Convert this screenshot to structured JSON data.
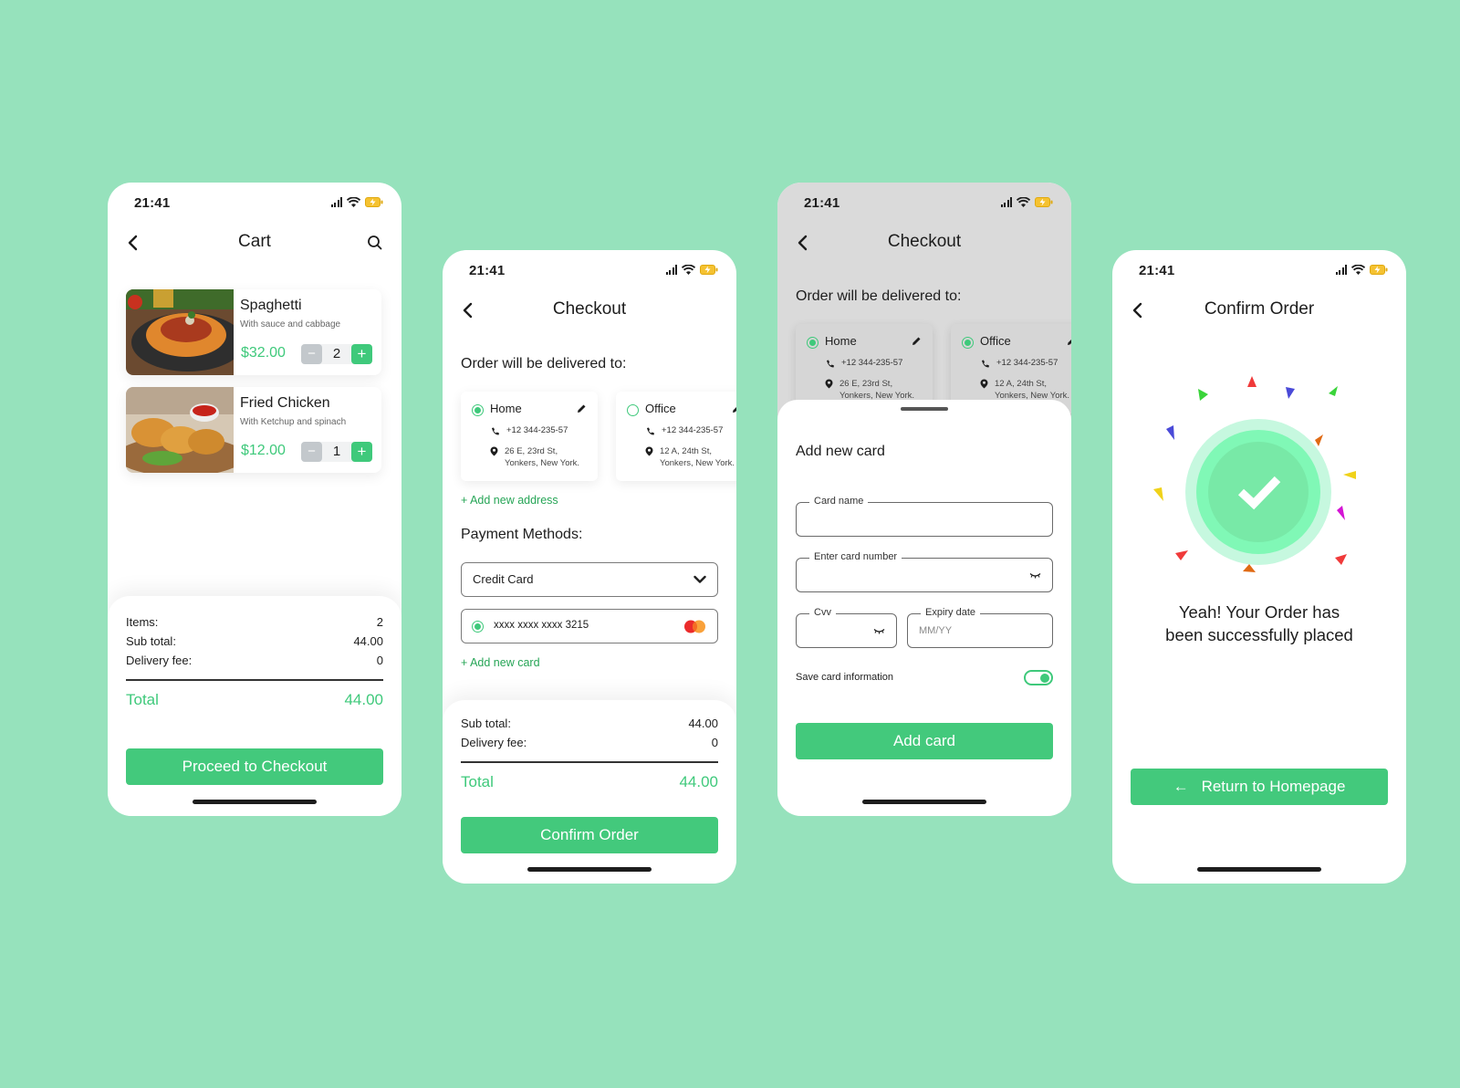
{
  "colors": {
    "background": "#96e2bc",
    "accent": "#43c97c",
    "accent_text": "#3fc97b",
    "link": "#26a556"
  },
  "status_bar": {
    "time": "21:41",
    "icons": [
      "signal-icon",
      "wifi-icon",
      "battery-charging-icon"
    ]
  },
  "cart": {
    "title": "Cart",
    "back_icon": "chevron-left-icon",
    "search_icon": "search-icon",
    "items": [
      {
        "name": "Spaghetti",
        "description": "With sauce and cabbage",
        "price": "$32.00",
        "quantity": "2",
        "image": "spaghetti-photo"
      },
      {
        "name": "Fried Chicken",
        "description": "With Ketchup and spinach",
        "price": "$12.00",
        "quantity": "1",
        "image": "fried-chicken-photo"
      }
    ],
    "stepper": {
      "minus": "−",
      "plus": "+"
    },
    "summary": {
      "items_label": "Items:",
      "items_value": "2",
      "subtotal_label": "Sub total:",
      "subtotal_value": "44.00",
      "delivery_label": "Delivery fee:",
      "delivery_value": "0",
      "total_label": "Total",
      "total_value": "44.00"
    },
    "proceed_button": "Proceed to Checkout"
  },
  "checkout": {
    "title": "Checkout",
    "delivered_to_label": "Order will be delivered to:",
    "addresses": [
      {
        "label": "Home",
        "phone": "+12 344-235-57",
        "address_line1": "26 E, 23rd St,",
        "address_line2": "Yonkers, New York.",
        "selected": true
      },
      {
        "label": "Office",
        "phone": "+12 344-235-57",
        "address_line1": "12 A, 24th St,",
        "address_line2": "Yonkers, New York.",
        "selected": false
      }
    ],
    "add_address_link": "+ Add new address",
    "payment_label": "Payment Methods:",
    "payment_method_selected": "Credit Card",
    "saved_card": "xxxx xxxx xxxx 3215",
    "card_brand": "mastercard-icon",
    "add_card_link": "+ Add new card",
    "summary": {
      "subtotal_label": "Sub total:",
      "subtotal_value": "44.00",
      "delivery_label": "Delivery fee:",
      "delivery_value": "0",
      "total_label": "Total",
      "total_value": "44.00"
    },
    "confirm_button": "Confirm Order"
  },
  "add_card": {
    "background_title": "Checkout",
    "background_delivered_to": "Order will be delivered to:",
    "title": "Add new card",
    "fields": {
      "card_name_label": "Card name",
      "card_name_value": "",
      "card_number_label": "Enter card number",
      "card_number_value": "",
      "cvv_label": "Cvv",
      "cvv_value": "",
      "expiry_label": "Expiry date",
      "expiry_placeholder": "MM/YY"
    },
    "save_card_label": "Save card information",
    "save_card_enabled": true,
    "add_button": "Add card"
  },
  "confirm": {
    "title": "Confirm Order",
    "message_line1": "Yeah! Your Order has",
    "message_line2": "been successfully placed",
    "success_icon": "check-icon",
    "return_arrow": "←",
    "return_button": "Return to Homepage"
  }
}
